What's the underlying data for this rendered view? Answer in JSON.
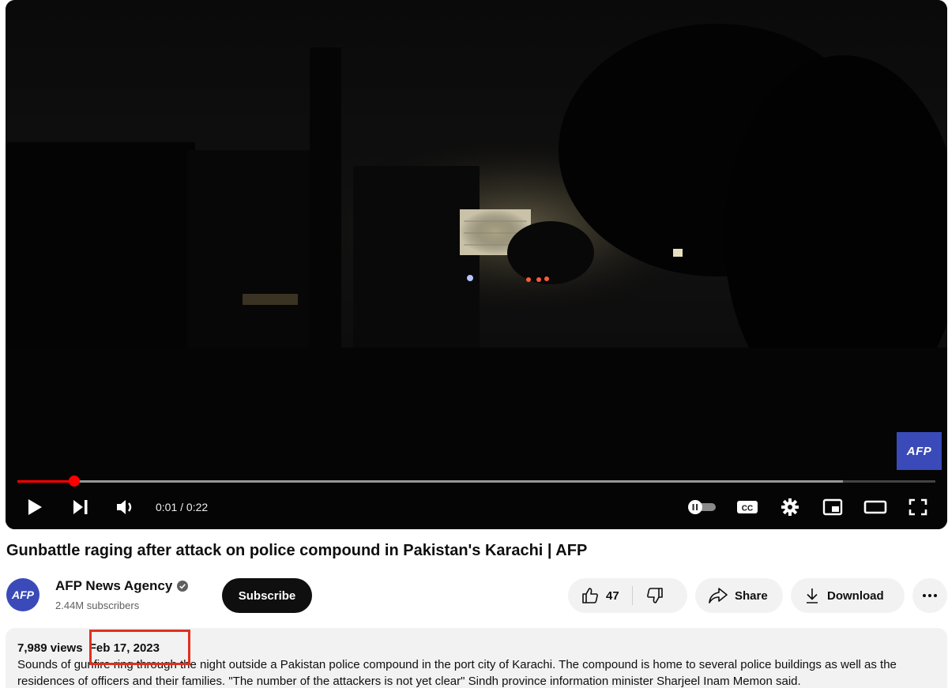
{
  "player": {
    "watermark": "AFP",
    "current_time": "0:01",
    "time_separator": " / ",
    "duration": "0:22",
    "progress_played_fraction": 0.062,
    "progress_loaded_fraction": 0.899,
    "cc_label": "CC"
  },
  "video": {
    "title": "Gunbattle raging after attack on police compound in Pakistan's Karachi | AFP"
  },
  "channel": {
    "avatar_text": "AFP",
    "name": "AFP News Agency",
    "subscribers": "2.44M subscribers",
    "subscribe_label": "Subscribe"
  },
  "actions": {
    "like_count": "47",
    "share_label": "Share",
    "download_label": "Download"
  },
  "description": {
    "views": "7,989 views",
    "date": "Feb 17, 2023",
    "text": "Sounds of gunfire ring through the night outside a Pakistan police compound in the port city of Karachi. The compound is home to several police buildings as well as the residences of officers and their families. \"The number of the attackers is not yet clear\" Sindh province information minister Sharjeel Inam Memon said."
  },
  "colors": {
    "progress_red": "#ff0000",
    "afp_blue": "#3a4ab8",
    "highlight_red": "#e0301e"
  }
}
